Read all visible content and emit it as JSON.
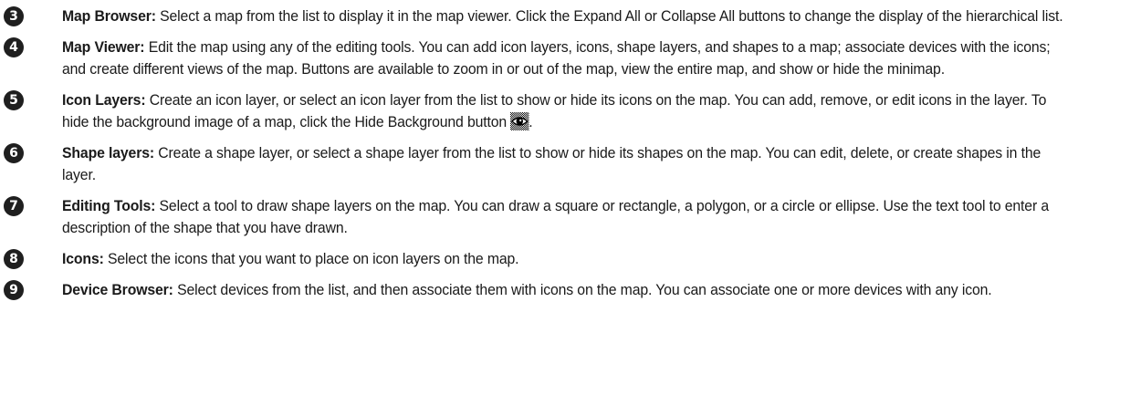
{
  "items": [
    {
      "number": "3",
      "term": "Map Browser:",
      "description": "Select a map from the list to display it in the map viewer. Click the Expand All or Collapse All buttons to change the display of the hierarchical list."
    },
    {
      "number": "4",
      "term": "Map Viewer:",
      "description": "Edit the map using any of the editing tools. You can add icon layers, icons, shape layers, and shapes to a map; associate devices with the icons; and create different views of the map. Buttons are available to zoom in or out of the map, view the entire map, and show or hide the minimap."
    },
    {
      "number": "5",
      "term": "Icon Layers:",
      "description": "Create an icon layer, or select an icon layer from the list to show or hide its icons on the map. You can add, remove, or edit icons in the layer. To hide the background image of a map, click the Hide Background button",
      "trailing_icon": "hide-background-eye-icon",
      "trailing_text": "."
    },
    {
      "number": "6",
      "term": "Shape layers:",
      "description": "Create a shape layer, or select a shape layer from the list to show or hide its shapes on the map. You can edit, delete, or create shapes in the layer."
    },
    {
      "number": "7",
      "term": "Editing Tools:",
      "description": "Select a tool to draw shape layers on the map. You can draw a square or rectangle, a polygon, or a circle or ellipse. Use the text tool to enter a description of the shape that you have drawn."
    },
    {
      "number": "8",
      "term": "Icons:",
      "description": "Select the icons that you want to place on icon layers on the map."
    },
    {
      "number": "9",
      "term": "Device Browser:",
      "description": "Select devices from the list, and then associate them with icons on the map. You can associate one or more devices with any icon."
    }
  ]
}
